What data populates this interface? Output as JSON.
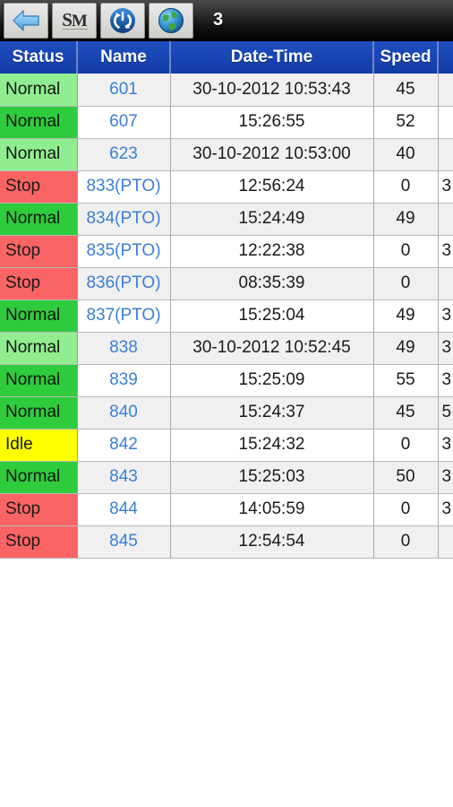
{
  "toolbar": {
    "buttons": [
      {
        "name": "back-button",
        "icon": "back-arrow-icon",
        "label": "Back"
      },
      {
        "name": "sm-logo-button",
        "icon": "sm-logo-icon",
        "label": "SM"
      },
      {
        "name": "refresh-button",
        "icon": "refresh-sync-icon",
        "label": "Refresh"
      },
      {
        "name": "globe-button",
        "icon": "globe-icon",
        "label": "Map"
      }
    ],
    "count": "3",
    "background": "#151515"
  },
  "table": {
    "headers": [
      "Status",
      "Name",
      "Date-Time",
      "Speed",
      ""
    ],
    "header_bg": "#1340aa",
    "status_colors": {
      "normal_light": "#90ee90",
      "normal_dark": "#2ecc3c",
      "stop": "#fa6464",
      "idle": "#ffff00"
    },
    "link_color": "#3a7fd5",
    "rows": [
      {
        "status": "Normal",
        "status_style": "normal-light",
        "name": "601",
        "datetime": "30-10-2012 10:53:43",
        "speed": "45",
        "extra": "",
        "stripe": "odd"
      },
      {
        "status": "Normal",
        "status_style": "normal-dark",
        "name": "607",
        "datetime": "15:26:55",
        "speed": "52",
        "extra": "",
        "stripe": "even"
      },
      {
        "status": "Normal",
        "status_style": "normal-light",
        "name": "623",
        "datetime": "30-10-2012 10:53:00",
        "speed": "40",
        "extra": "",
        "stripe": "odd"
      },
      {
        "status": "Stop",
        "status_style": "stop",
        "name": "833(PTO)",
        "datetime": "12:56:24",
        "speed": "0",
        "extra": "3",
        "stripe": "even"
      },
      {
        "status": "Normal",
        "status_style": "normal-dark",
        "name": "834(PTO)",
        "datetime": "15:24:49",
        "speed": "49",
        "extra": "",
        "stripe": "odd"
      },
      {
        "status": "Stop",
        "status_style": "stop",
        "name": "835(PTO)",
        "datetime": "12:22:38",
        "speed": "0",
        "extra": "3",
        "stripe": "even"
      },
      {
        "status": "Stop",
        "status_style": "stop",
        "name": "836(PTO)",
        "datetime": "08:35:39",
        "speed": "0",
        "extra": "",
        "stripe": "odd"
      },
      {
        "status": "Normal",
        "status_style": "normal-dark",
        "name": "837(PTO)",
        "datetime": "15:25:04",
        "speed": "49",
        "extra": "3",
        "stripe": "even"
      },
      {
        "status": "Normal",
        "status_style": "normal-light",
        "name": "838",
        "datetime": "30-10-2012 10:52:45",
        "speed": "49",
        "extra": "3",
        "stripe": "odd"
      },
      {
        "status": "Normal",
        "status_style": "normal-dark",
        "name": "839",
        "datetime": "15:25:09",
        "speed": "55",
        "extra": "3",
        "stripe": "even"
      },
      {
        "status": "Normal",
        "status_style": "normal-dark",
        "name": "840",
        "datetime": "15:24:37",
        "speed": "45",
        "extra": "5",
        "stripe": "odd"
      },
      {
        "status": "Idle",
        "status_style": "idle",
        "name": "842",
        "datetime": "15:24:32",
        "speed": "0",
        "extra": "3",
        "stripe": "even"
      },
      {
        "status": "Normal",
        "status_style": "normal-dark",
        "name": "843",
        "datetime": "15:25:03",
        "speed": "50",
        "extra": "3",
        "stripe": "odd"
      },
      {
        "status": "Stop",
        "status_style": "stop",
        "name": "844",
        "datetime": "14:05:59",
        "speed": "0",
        "extra": "3",
        "stripe": "even"
      },
      {
        "status": "Stop",
        "status_style": "stop",
        "name": "845",
        "datetime": "12:54:54",
        "speed": "0",
        "extra": "",
        "stripe": "odd"
      }
    ]
  }
}
